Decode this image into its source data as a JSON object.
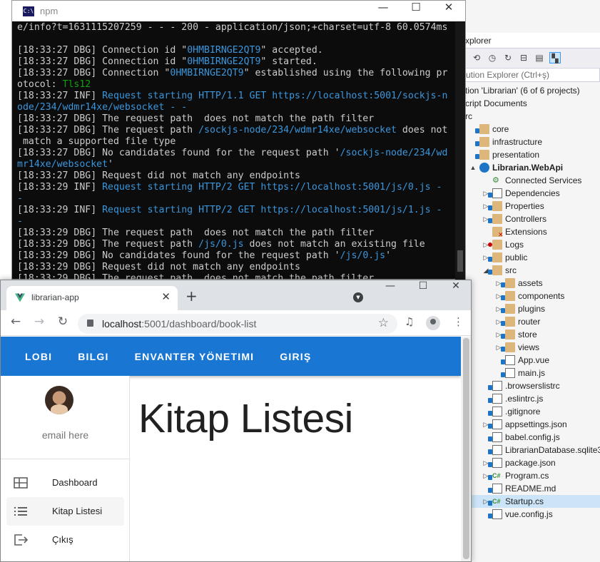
{
  "console": {
    "title": "npm",
    "icon_label": "C:\\",
    "lines": [
      [
        {
          "t": "e/info?t=1631115207259 - - - 200 - application/json;+charset=utf-8 60.0574ms",
          "c": ""
        }
      ],
      [
        {
          "t": "",
          "c": ""
        }
      ],
      [
        {
          "t": "[18:33:27 DBG] Connection id \"",
          "c": ""
        },
        {
          "t": "0HMBIRNGE2QT9",
          "c": "cy"
        },
        {
          "t": "\" accepted.",
          "c": ""
        }
      ],
      [
        {
          "t": "[18:33:27 DBG] Connection id \"",
          "c": ""
        },
        {
          "t": "0HMBIRNGE2QT9",
          "c": "cy"
        },
        {
          "t": "\" started.",
          "c": ""
        }
      ],
      [
        {
          "t": "[18:33:27 DBG] Connection \"",
          "c": ""
        },
        {
          "t": "0HMBIRNGE2QT9",
          "c": "cy"
        },
        {
          "t": "\" established using the following pr",
          "c": ""
        }
      ],
      [
        {
          "t": "otocol: ",
          "c": ""
        },
        {
          "t": "Tls12",
          "c": "gr"
        }
      ],
      [
        {
          "t": "[18:33:27 INF] ",
          "c": ""
        },
        {
          "t": "Request starting HTTP/1.1 GET https://localhost:5001/sockjs-n",
          "c": "cy"
        }
      ],
      [
        {
          "t": "ode/234/wdmr14xe/websocket - -",
          "c": "cy"
        }
      ],
      [
        {
          "t": "[18:33:27 DBG] The request path  does not match the path filter",
          "c": ""
        }
      ],
      [
        {
          "t": "[18:33:27 DBG] The request path ",
          "c": ""
        },
        {
          "t": "/sockjs-node/234/wdmr14xe/websocket",
          "c": "cy"
        },
        {
          "t": " does not",
          "c": ""
        }
      ],
      [
        {
          "t": " match a supported file type",
          "c": ""
        }
      ],
      [
        {
          "t": "[18:33:27 DBG] No candidates found for the request path '",
          "c": ""
        },
        {
          "t": "/sockjs-node/234/wd",
          "c": "cy"
        }
      ],
      [
        {
          "t": "mr14xe/websocket",
          "c": "cy"
        },
        {
          "t": "'",
          "c": ""
        }
      ],
      [
        {
          "t": "[18:33:27 DBG] Request did not match any endpoints",
          "c": ""
        }
      ],
      [
        {
          "t": "[18:33:29 INF] ",
          "c": ""
        },
        {
          "t": "Request starting HTTP/2 GET https://localhost:5001/js/0.js -",
          "c": "cy"
        }
      ],
      [
        {
          "t": "-",
          "c": "cy"
        }
      ],
      [
        {
          "t": "[18:33:29 INF] ",
          "c": ""
        },
        {
          "t": "Request starting HTTP/2 GET https://localhost:5001/js/1.js -",
          "c": "cy"
        }
      ],
      [
        {
          "t": "-",
          "c": "cy"
        }
      ],
      [
        {
          "t": "[18:33:29 DBG] The request path  does not match the path filter",
          "c": ""
        }
      ],
      [
        {
          "t": "[18:33:29 DBG] The request path ",
          "c": ""
        },
        {
          "t": "/js/0.js",
          "c": "cy"
        },
        {
          "t": " does not match an existing file",
          "c": ""
        }
      ],
      [
        {
          "t": "[18:33:29 DBG] No candidates found for the request path '",
          "c": ""
        },
        {
          "t": "/js/0.js",
          "c": "cy"
        },
        {
          "t": "'",
          "c": ""
        }
      ],
      [
        {
          "t": "[18:33:29 DBG] Request did not match any endpoints",
          "c": ""
        }
      ],
      [
        {
          "t": "[18:33:29 DBG] The request path  does not match the path filter",
          "c": ""
        }
      ]
    ]
  },
  "solution_explorer": {
    "title": "xplorer",
    "search_placeholder": "ution Explorer (Ctrl+ş)",
    "tree": [
      {
        "label": "tion 'Librarian' (6 of 6 projects)",
        "indent": 0,
        "icon": "none",
        "exp": ""
      },
      {
        "label": "cript Documents",
        "indent": 0,
        "icon": "none",
        "exp": ""
      },
      {
        "label": "rc",
        "indent": 0,
        "icon": "none",
        "exp": ""
      },
      {
        "label": "core",
        "indent": 1,
        "icon": "folder",
        "exp": ""
      },
      {
        "label": "infrastructure",
        "indent": 1,
        "icon": "folder",
        "exp": ""
      },
      {
        "label": "presentation",
        "indent": 1,
        "icon": "folder",
        "exp": ""
      },
      {
        "label": "Librarian.WebApi",
        "indent": 2,
        "icon": "web",
        "exp": "▲",
        "bold": true
      },
      {
        "label": "Connected Services",
        "indent": 3,
        "icon": "plug",
        "exp": ""
      },
      {
        "label": "Dependencies",
        "indent": 3,
        "icon": "deps",
        "exp": "▷"
      },
      {
        "label": "Properties",
        "indent": 3,
        "icon": "folder",
        "exp": "▷"
      },
      {
        "label": "Controllers",
        "indent": 3,
        "icon": "folder",
        "exp": "▷"
      },
      {
        "label": "Extensions",
        "indent": 3,
        "icon": "folder-x",
        "exp": ""
      },
      {
        "label": "Logs",
        "indent": 3,
        "icon": "folder-minus",
        "exp": "▷"
      },
      {
        "label": "public",
        "indent": 3,
        "icon": "folder",
        "exp": "▷"
      },
      {
        "label": "src",
        "indent": 3,
        "icon": "folder",
        "exp": "◢"
      },
      {
        "label": "assets",
        "indent": 4,
        "icon": "folder",
        "exp": "▷"
      },
      {
        "label": "components",
        "indent": 4,
        "icon": "folder",
        "exp": "▷"
      },
      {
        "label": "plugins",
        "indent": 4,
        "icon": "folder",
        "exp": "▷"
      },
      {
        "label": "router",
        "indent": 4,
        "icon": "folder",
        "exp": "▷"
      },
      {
        "label": "store",
        "indent": 4,
        "icon": "folder",
        "exp": "▷"
      },
      {
        "label": "views",
        "indent": 4,
        "icon": "folder",
        "exp": "▷"
      },
      {
        "label": "App.vue",
        "indent": 4,
        "icon": "file",
        "exp": ""
      },
      {
        "label": "main.js",
        "indent": 4,
        "icon": "js",
        "exp": ""
      },
      {
        "label": ".browserslistrc",
        "indent": 3,
        "icon": "file",
        "exp": ""
      },
      {
        "label": ".eslintrc.js",
        "indent": 3,
        "icon": "js",
        "exp": ""
      },
      {
        "label": ".gitignore",
        "indent": 3,
        "icon": "file",
        "exp": ""
      },
      {
        "label": "appsettings.json",
        "indent": 3,
        "icon": "js",
        "exp": "▷"
      },
      {
        "label": "babel.config.js",
        "indent": 3,
        "icon": "js",
        "exp": ""
      },
      {
        "label": "LibrarianDatabase.sqlite3",
        "indent": 3,
        "icon": "file",
        "exp": ""
      },
      {
        "label": "package.json",
        "indent": 3,
        "icon": "js",
        "exp": "▷"
      },
      {
        "label": "Program.cs",
        "indent": 3,
        "icon": "cs",
        "exp": "▷"
      },
      {
        "label": "README.md",
        "indent": 3,
        "icon": "file",
        "exp": ""
      },
      {
        "label": "Startup.cs",
        "indent": 3,
        "icon": "cs",
        "exp": "▷",
        "selected": true
      },
      {
        "label": "vue.config.js",
        "indent": 3,
        "icon": "js",
        "exp": ""
      }
    ]
  },
  "browser": {
    "tab_title": "librarian-app",
    "url_host": "localhost",
    "url_rest": ":5001/dashboard/book-list"
  },
  "app": {
    "nav": [
      "LOBI",
      "BILGI",
      "ENVANTER YÖNETIMI",
      "GIRIŞ"
    ],
    "email": "email here",
    "drawer_items": [
      {
        "label": "Dashboard",
        "icon": "dashboard-icon",
        "active": false
      },
      {
        "label": "Kitap Listesi",
        "icon": "list-icon",
        "active": true
      },
      {
        "label": "Çıkış",
        "icon": "logout-icon",
        "active": false
      }
    ],
    "page_title": "Kitap Listesi",
    "accent": "#1976d2"
  }
}
